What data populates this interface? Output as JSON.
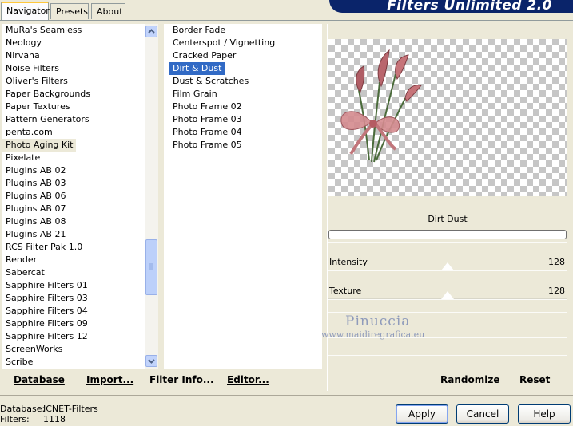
{
  "tabs": [
    "Navigator",
    "Presets",
    "About"
  ],
  "banner_title": "Filters Unlimited 2.0",
  "categories": [
    "MuRa's Seamless",
    "Neology",
    "Nirvana",
    "Noise Filters",
    "Oliver's Filters",
    "Paper Backgrounds",
    "Paper Textures",
    "Pattern Generators",
    "penta.com",
    "Photo Aging Kit",
    "Pixelate",
    "Plugins AB 02",
    "Plugins AB 03",
    "Plugins AB 06",
    "Plugins AB 07",
    "Plugins AB 08",
    "Plugins AB 21",
    "RCS Filter Pak 1.0",
    "Render",
    "Sabercat",
    "Sapphire Filters 01",
    "Sapphire Filters 03",
    "Sapphire Filters 04",
    "Sapphire Filters 09",
    "Sapphire Filters 12",
    "ScreenWorks",
    "Scribe"
  ],
  "selected_category": "Photo Aging Kit",
  "filters": [
    "Border Fade",
    "Centerspot / Vignetting",
    "Cracked Paper",
    "Dirt & Dust",
    "Dust & Scratches",
    "Film Grain",
    "Photo Frame 02",
    "Photo Frame 03",
    "Photo Frame 04",
    "Photo Frame 05"
  ],
  "selected_filter": "Dirt & Dust",
  "preview": {
    "filter_name": "Dirt  Dust",
    "watermark_name": "Pinuccia",
    "watermark_url": "www.maidiregrafica.eu"
  },
  "params": [
    {
      "label": "Intensity",
      "value": "128",
      "level": 0.5
    },
    {
      "label": "Texture",
      "value": "128",
      "level": 0.5
    }
  ],
  "bottom_links": {
    "database": "Database",
    "import": "Import...",
    "filter_info": "Filter Info...",
    "editor": "Editor...",
    "randomize": "Randomize",
    "reset": "Reset"
  },
  "status": {
    "database_label": "Database:",
    "database_value": "ICNET-Filters",
    "filters_label": "Filters:",
    "filters_value": "1118"
  },
  "buttons": {
    "apply": "Apply",
    "cancel": "Cancel",
    "help": "Help"
  },
  "colors": {
    "accent": "#316ac5",
    "banner": "#0a246a",
    "face": "#ece9d8"
  }
}
